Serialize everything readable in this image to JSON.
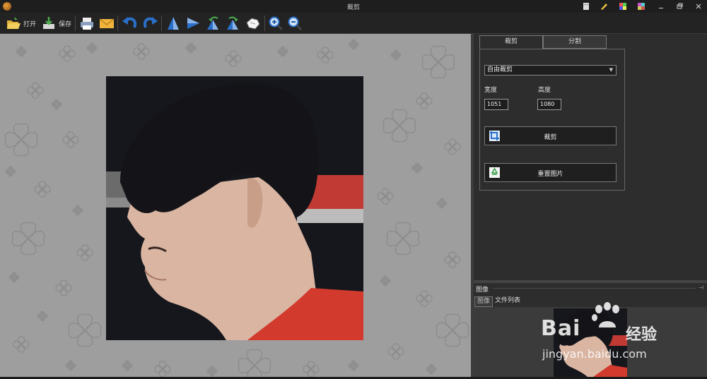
{
  "window": {
    "title": "裁剪",
    "controls": [
      "pages-icon",
      "pen-icon",
      "palette-icon",
      "grid-icon",
      "minimize-icon",
      "restore-icon",
      "close-icon"
    ]
  },
  "toolbar": {
    "open_label": "打开",
    "save_label": "保存",
    "tools": [
      "print-icon",
      "mail-icon",
      "undo-icon",
      "redo-icon",
      "flip-vertical-icon",
      "flip-horizontal-icon",
      "rotate-left-icon",
      "rotate-right-icon",
      "hand-icon",
      "zoom-in-icon",
      "zoom-out-icon"
    ]
  },
  "crop_panel": {
    "tabs": [
      {
        "label": "裁剪",
        "active": true
      },
      {
        "label": "分割",
        "active": false
      }
    ],
    "mode_select": "自由裁剪",
    "width_label": "宽度",
    "height_label": "高度",
    "width_value": "1051",
    "height_value": "1080",
    "crop_button": "裁剪",
    "reset_button": "重置图片"
  },
  "image_panel": {
    "header": "图像",
    "tabs": [
      {
        "label": "图像",
        "active": true
      },
      {
        "label": "文件列表",
        "active": false
      }
    ]
  },
  "watermark": {
    "brand": "Bai",
    "brand_suffix": "经验",
    "url": "jingyan.baidu.com"
  },
  "colors": {
    "background": "#2b2b2b",
    "canvas": "#9e9e9e",
    "accent_blue": "#2a6fc9",
    "photo_red": "#d23a2e"
  }
}
